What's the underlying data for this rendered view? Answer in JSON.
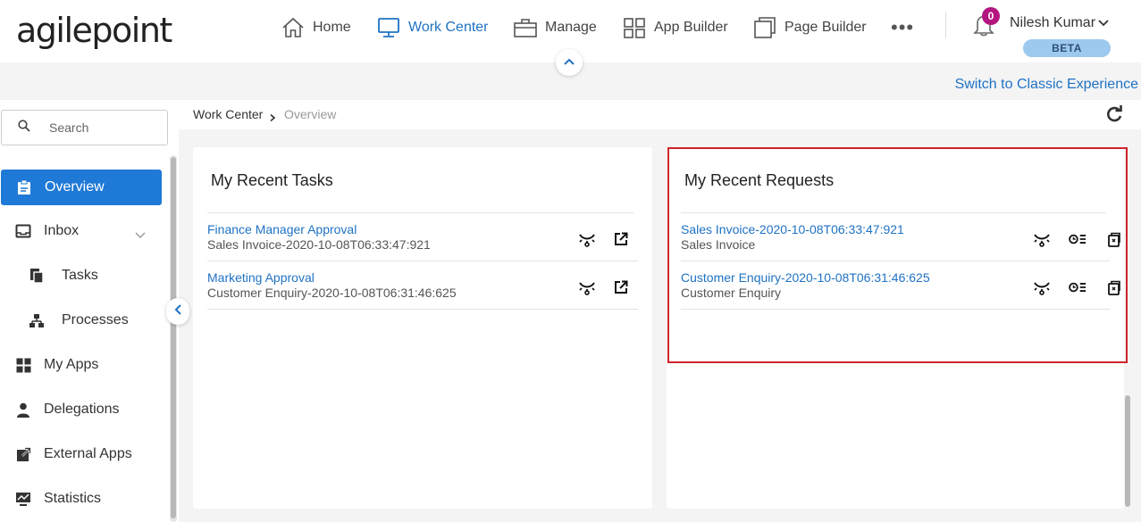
{
  "header": {
    "logo_text": "agilepoint",
    "nav": [
      {
        "label": "Home",
        "icon": "home-icon"
      },
      {
        "label": "Work Center",
        "icon": "monitor-icon",
        "active": true
      },
      {
        "label": "Manage",
        "icon": "briefcase-icon"
      },
      {
        "label": "App Builder",
        "icon": "grid-icon"
      },
      {
        "label": "Page Builder",
        "icon": "pages-icon"
      }
    ],
    "more_label": "•••",
    "notification_count": "0",
    "user_name": "Nilesh Kumar",
    "beta_label": "BETA",
    "switch_link": "Switch to Classic Experience"
  },
  "sidebar": {
    "search_placeholder": "Search",
    "items": [
      {
        "label": "Overview",
        "icon": "clipboard-icon",
        "active": true
      },
      {
        "label": "Inbox",
        "icon": "inbox-icon"
      },
      {
        "label": "Tasks",
        "icon": "tasks-icon"
      },
      {
        "label": "Processes",
        "icon": "process-tree-icon"
      },
      {
        "label": "My Apps",
        "icon": "apps-grid-icon"
      },
      {
        "label": "Delegations",
        "icon": "person-icon"
      },
      {
        "label": "External Apps",
        "icon": "external-link-icon"
      },
      {
        "label": "Statistics",
        "icon": "statistics-icon"
      }
    ]
  },
  "breadcrumb": {
    "parent": "Work Center",
    "current": "Overview"
  },
  "recent_tasks": {
    "title": "My Recent Tasks",
    "rows": [
      {
        "link": "Finance Manager Approval",
        "sub": "Sales Invoice-2020-10-08T06:33:47:921"
      },
      {
        "link": "Marketing Approval",
        "sub": "Customer Enquiry-2020-10-08T06:31:46:625"
      }
    ]
  },
  "recent_requests": {
    "title": "My Recent Requests",
    "rows": [
      {
        "link": "Sales Invoice-2020-10-08T06:33:47:921",
        "sub": "Sales Invoice"
      },
      {
        "link": "Customer Enquiry-2020-10-08T06:31:46:625",
        "sub": "Customer Enquiry"
      }
    ]
  },
  "colors": {
    "accent": "#1f72c4",
    "active_sidebar": "#1f79d6",
    "badge": "#b41680",
    "highlight": "#d0242b"
  }
}
